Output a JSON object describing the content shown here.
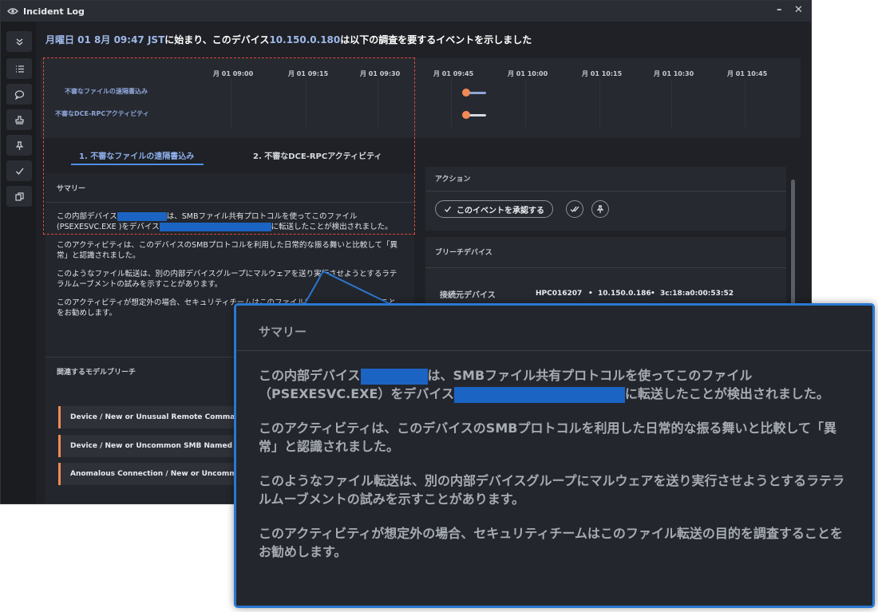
{
  "window": {
    "title": "Incident Log",
    "minimize_glyph": "–",
    "close_glyph": "✕"
  },
  "sidebar": {
    "items": [
      {
        "icon": "chevron-double-down-icon"
      },
      {
        "icon": "list-icon"
      },
      {
        "icon": "comment-icon"
      },
      {
        "icon": "stamp-icon"
      },
      {
        "icon": "pin-icon"
      },
      {
        "icon": "checkmark-icon"
      },
      {
        "icon": "copy-icon"
      }
    ]
  },
  "headline": {
    "date": "月曜日 01 8月 09:47 JST",
    "mid": "に始まり、このデバイス",
    "ip": "10.150.0.180",
    "tail": "は以下の調査を要するイベントを示しました"
  },
  "timeline": {
    "ticks": [
      "月 01 09:00",
      "月 01 09:15",
      "月 01 09:30",
      "月 01 09:45",
      "月 01 10:00",
      "月 01 10:15",
      "月 01 10:30",
      "月 01 10:45"
    ],
    "rows": [
      "不審なファイルの遠隔書込み",
      "不審なDCE-RPCアクティビティ"
    ],
    "event_color": "#f08a57"
  },
  "tabs": [
    "1. 不審なファイルの遠隔書込み",
    "2. 不審なDCE-RPCアクティビティ"
  ],
  "summary": {
    "title": "サマリー",
    "p1a": "この内部デバイス",
    "p1b": "は、SMBファイル共有プロトコルを使ってこのファイル(",
    "p1c": "PSEXESVC.EXE )をデバイス",
    "p1d": "に転送したことが検出されました。",
    "p2": "このアクティビティは、このデバイスのSMBプロトコルを利用した日常的な振る舞いと比較して「異常」と認識されました。",
    "p3": "このようなファイル転送は、別の内部デバイスグループにマルウェアを送り実行させようとするラテラルムーブメントの試みを示すことがあります。",
    "p4": "このアクティビティが想定外の場合、セキュリティチームはこのファイル転送の目的を調査することをお勧めします。"
  },
  "related": {
    "title": "関連するモデルブリーチ",
    "items": [
      "Device / New or Unusual Remote Command E",
      "Device / New or Uncommon SMB Named Pipe",
      "Anomalous Connection / New or Uncommon S"
    ]
  },
  "actions": {
    "title": "アクション",
    "ack_label": "このイベントを承認する"
  },
  "breach_device": {
    "title": "ブリーチデバイス",
    "label": "接続元デバイス",
    "hostname": "HPC016207",
    "ip": "10.150.0.186",
    "mac": "3c:18:a0:00:53:52"
  },
  "callout": {
    "title": "サマリー",
    "p1a": "この内部デバイス",
    "p1b": "は、SMBファイル共有プロトコルを使ってこのファイル（",
    "p1c": "PSEXESVC.EXE）をデバイス",
    "p1d": "に転送したことが検出されました。",
    "p2": "このアクティビティは、このデバイスのSMBプロトコルを利用した日常的な振る舞いと比較して「異常」と認識されました。",
    "p3": "このようなファイル転送は、別の内部デバイスグループにマルウェアを送り実行させようとするラテラルムーブメントの試みを示すことがあります。",
    "p4": "このアクティビティが想定外の場合、セキュリティチームはこのファイル転送の目的を調査することをお勧めします。"
  },
  "colors": {
    "accent": "#2a78d2",
    "redaction": "#1b64c4",
    "highlight_box": "#e04a3a"
  }
}
